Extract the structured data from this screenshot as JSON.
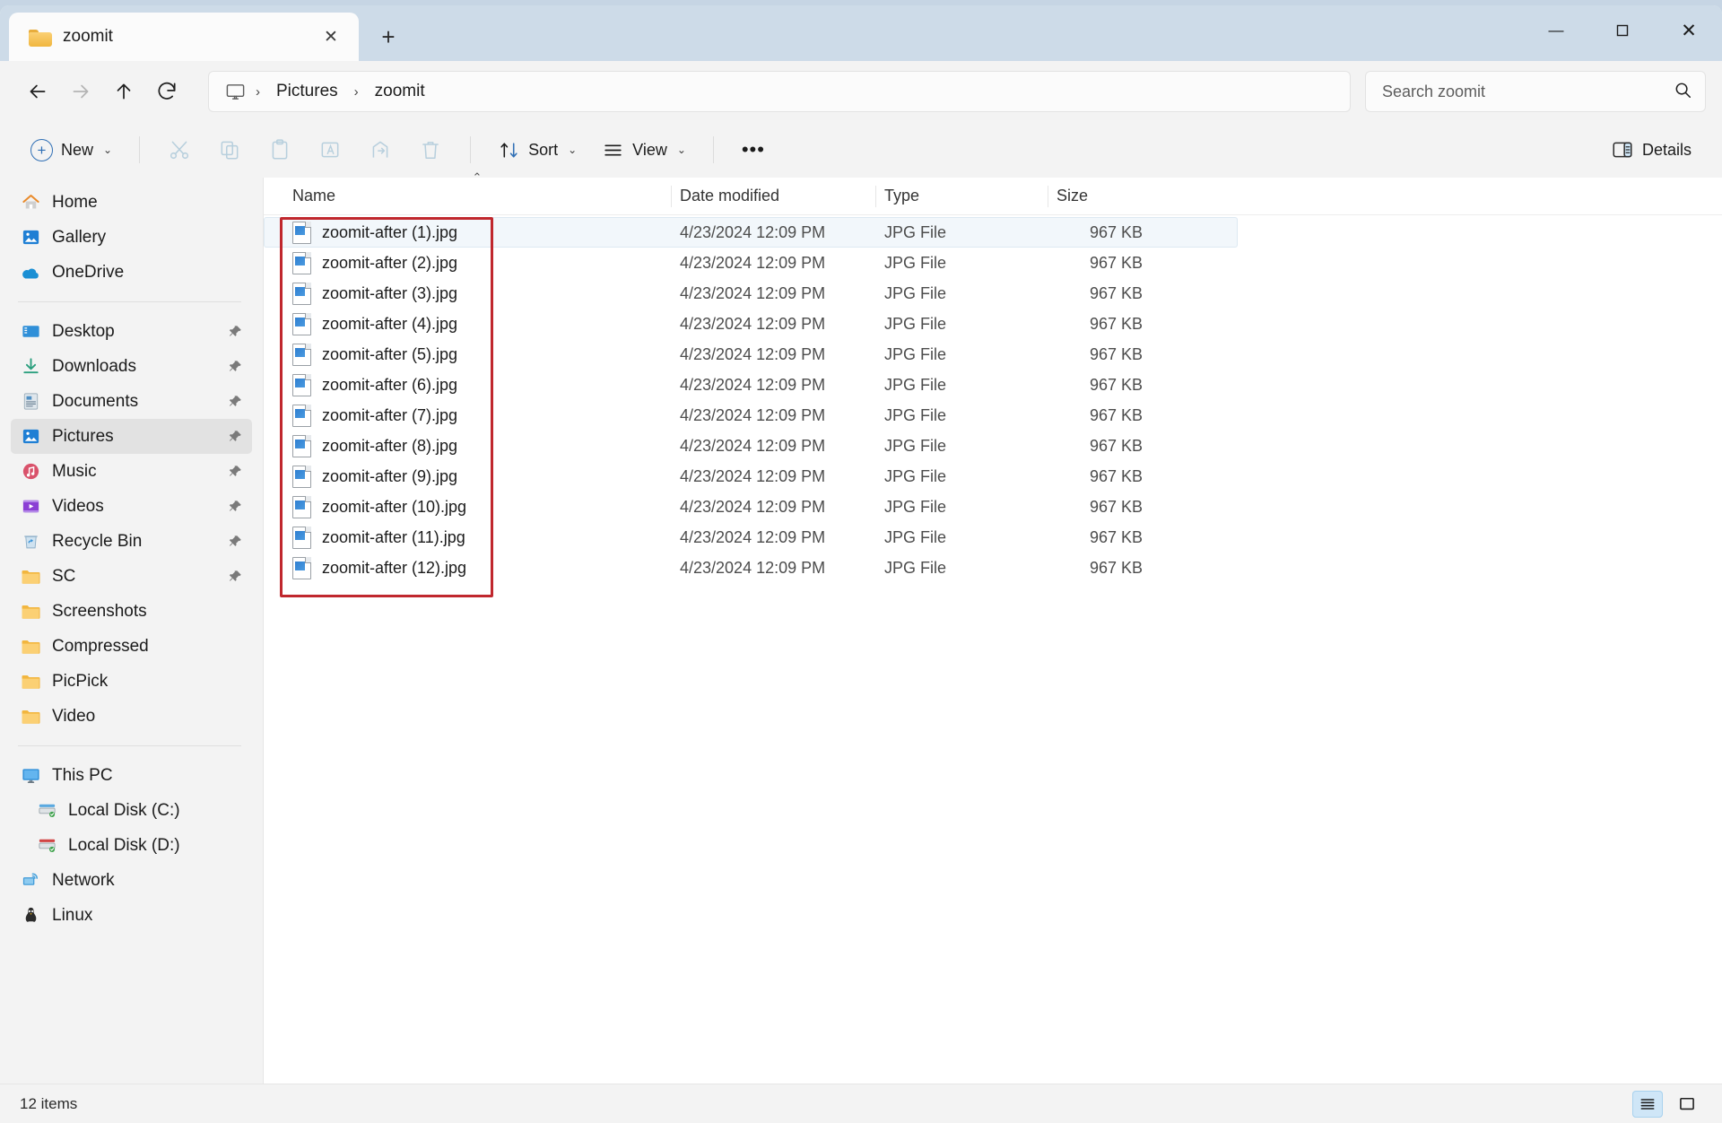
{
  "window": {
    "controls": {
      "minimize": "—",
      "maximize": "☐",
      "close": "✕"
    }
  },
  "tabs": {
    "items": [
      {
        "title": "zoomit",
        "icon": "folder-icon",
        "close_label": "✕"
      }
    ],
    "new_tab_label": "+"
  },
  "navbar": {
    "back_label": "←",
    "forward_label": "→",
    "up_label": "↑",
    "refresh_label": "⟳",
    "breadcrumb": {
      "root_icon": "this-pc-monitor-icon",
      "separator": "›",
      "items": [
        "Pictures",
        "zoomit"
      ]
    }
  },
  "search": {
    "placeholder": "Search zoomit",
    "value": "",
    "icon": "search-icon"
  },
  "toolbar": {
    "new_label": "New",
    "new_chevron": "⌄",
    "cut_label": "Cut",
    "copy_label": "Copy",
    "paste_label": "Paste",
    "rename_label": "Rename",
    "share_label": "Share",
    "delete_label": "Delete",
    "sort_label": "Sort",
    "sort_chevron": "⌄",
    "view_label": "View",
    "view_chevron": "⌄",
    "more_label": "•••",
    "details_label": "Details"
  },
  "sidebar": {
    "groups": [
      {
        "items": [
          {
            "label": "Home",
            "icon": "home-icon",
            "pinned": false,
            "selected": false
          },
          {
            "label": "Gallery",
            "icon": "gallery-icon",
            "pinned": false,
            "selected": false
          },
          {
            "label": "OneDrive",
            "icon": "onedrive-icon",
            "pinned": false,
            "selected": false
          }
        ]
      },
      {
        "items": [
          {
            "label": "Desktop",
            "icon": "desktop-icon",
            "pinned": true,
            "selected": false
          },
          {
            "label": "Downloads",
            "icon": "downloads-icon",
            "pinned": true,
            "selected": false
          },
          {
            "label": "Documents",
            "icon": "documents-icon",
            "pinned": true,
            "selected": false
          },
          {
            "label": "Pictures",
            "icon": "pictures-icon",
            "pinned": true,
            "selected": true
          },
          {
            "label": "Music",
            "icon": "music-icon",
            "pinned": true,
            "selected": false
          },
          {
            "label": "Videos",
            "icon": "videos-icon",
            "pinned": true,
            "selected": false
          },
          {
            "label": "Recycle Bin",
            "icon": "recycle-bin-icon",
            "pinned": true,
            "selected": false
          },
          {
            "label": "SC",
            "icon": "folder-icon",
            "pinned": true,
            "selected": false
          },
          {
            "label": "Screenshots",
            "icon": "folder-icon",
            "pinned": false,
            "selected": false
          },
          {
            "label": "Compressed",
            "icon": "folder-icon",
            "pinned": false,
            "selected": false
          },
          {
            "label": "PicPick",
            "icon": "folder-icon",
            "pinned": false,
            "selected": false
          },
          {
            "label": "Video",
            "icon": "folder-icon",
            "pinned": false,
            "selected": false
          }
        ]
      },
      {
        "items": [
          {
            "label": "This PC",
            "icon": "this-pc-icon",
            "pinned": false,
            "selected": false
          },
          {
            "label": "Local Disk (C:)",
            "icon": "disk-c-icon",
            "pinned": false,
            "selected": false
          },
          {
            "label": "Local Disk (D:)",
            "icon": "disk-d-icon",
            "pinned": false,
            "selected": false
          },
          {
            "label": "Network",
            "icon": "network-icon",
            "pinned": false,
            "selected": false
          },
          {
            "label": "Linux",
            "icon": "linux-icon",
            "pinned": false,
            "selected": false
          }
        ]
      }
    ],
    "pin_glyph": "📌"
  },
  "filelist": {
    "columns": [
      {
        "key": "name",
        "label": "Name",
        "sorted": "asc",
        "sort_caret": "⌃"
      },
      {
        "key": "date",
        "label": "Date modified",
        "sorted": "",
        "sort_caret": ""
      },
      {
        "key": "type",
        "label": "Type",
        "sorted": "",
        "sort_caret": ""
      },
      {
        "key": "size",
        "label": "Size",
        "sorted": "",
        "sort_caret": ""
      }
    ],
    "rows": [
      {
        "name": "zoomit-after (1).jpg",
        "date": "4/23/2024 12:09 PM",
        "type": "JPG File",
        "size": "967 KB",
        "hovered": true
      },
      {
        "name": "zoomit-after (2).jpg",
        "date": "4/23/2024 12:09 PM",
        "type": "JPG File",
        "size": "967 KB",
        "hovered": false
      },
      {
        "name": "zoomit-after (3).jpg",
        "date": "4/23/2024 12:09 PM",
        "type": "JPG File",
        "size": "967 KB",
        "hovered": false
      },
      {
        "name": "zoomit-after (4).jpg",
        "date": "4/23/2024 12:09 PM",
        "type": "JPG File",
        "size": "967 KB",
        "hovered": false
      },
      {
        "name": "zoomit-after (5).jpg",
        "date": "4/23/2024 12:09 PM",
        "type": "JPG File",
        "size": "967 KB",
        "hovered": false
      },
      {
        "name": "zoomit-after (6).jpg",
        "date": "4/23/2024 12:09 PM",
        "type": "JPG File",
        "size": "967 KB",
        "hovered": false
      },
      {
        "name": "zoomit-after (7).jpg",
        "date": "4/23/2024 12:09 PM",
        "type": "JPG File",
        "size": "967 KB",
        "hovered": false
      },
      {
        "name": "zoomit-after (8).jpg",
        "date": "4/23/2024 12:09 PM",
        "type": "JPG File",
        "size": "967 KB",
        "hovered": false
      },
      {
        "name": "zoomit-after (9).jpg",
        "date": "4/23/2024 12:09 PM",
        "type": "JPG File",
        "size": "967 KB",
        "hovered": false
      },
      {
        "name": "zoomit-after (10).jpg",
        "date": "4/23/2024 12:09 PM",
        "type": "JPG File",
        "size": "967 KB",
        "hovered": false
      },
      {
        "name": "zoomit-after (11).jpg",
        "date": "4/23/2024 12:09 PM",
        "type": "JPG File",
        "size": "967 KB",
        "hovered": false
      },
      {
        "name": "zoomit-after (12).jpg",
        "date": "4/23/2024 12:09 PM",
        "type": "JPG File",
        "size": "967 KB",
        "hovered": false
      }
    ]
  },
  "annotation": {
    "color": "#c0272d",
    "shape": "rectangle",
    "target": "name-column-filenames"
  },
  "statusbar": {
    "item_count": "12 items",
    "view_list_label": "List view",
    "view_tiles_label": "Large icons view",
    "active_view": "list"
  }
}
